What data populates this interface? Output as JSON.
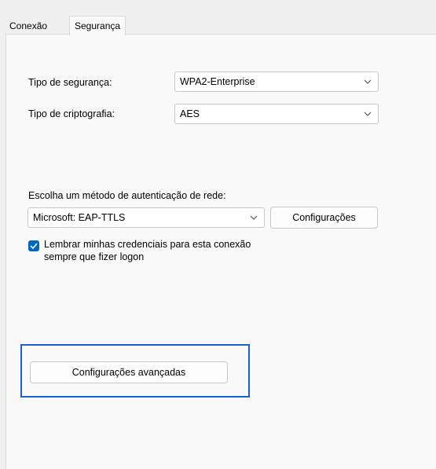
{
  "tabs": [
    {
      "label": "Conexão"
    },
    {
      "label": "Segurança"
    }
  ],
  "security": {
    "type_label": "Tipo de segurança:",
    "type_value": "WPA2-Enterprise",
    "encryption_label": "Tipo de criptografia:",
    "encryption_value": "AES"
  },
  "auth": {
    "method_label": "Escolha um método de autenticação de rede:",
    "method_value": "Microsoft: EAP-TTLS",
    "settings_button": "Configurações",
    "remember_line1": "Lembrar minhas credenciais para esta conexão",
    "remember_line2": "sempre que fizer logon",
    "remember_checked": true
  },
  "advanced": {
    "button_label": "Configurações avançadas"
  },
  "colors": {
    "accent": "#0067c0",
    "highlight_border": "#1f5fd6"
  }
}
